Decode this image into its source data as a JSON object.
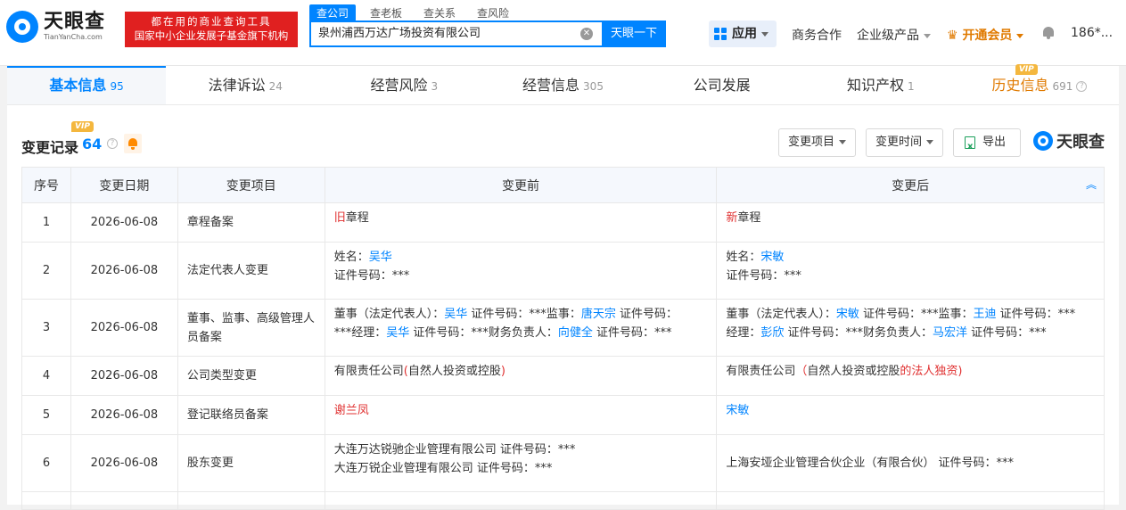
{
  "header": {
    "logo_cn": "天眼查",
    "logo_en": "TianYanCha.com",
    "slogan_line1": "都在用的商业查询工具",
    "slogan_line2": "国家中小企业发展子基金旗下机构",
    "search_tabs": [
      "查公司",
      "查老板",
      "查关系",
      "查风险"
    ],
    "search_value": "泉州浦西万达广场投资有限公司",
    "search_button": "天眼一下",
    "apps_label": "应用",
    "nav": {
      "business": "商务合作",
      "enterprise": "企业级产品",
      "vip": "开通会员",
      "user": "186*..."
    }
  },
  "tabs": [
    {
      "label": "基本信息",
      "count": "95"
    },
    {
      "label": "法律诉讼",
      "count": "24"
    },
    {
      "label": "经营风险",
      "count": "3"
    },
    {
      "label": "经营信息",
      "count": "305"
    },
    {
      "label": "公司发展",
      "count": ""
    },
    {
      "label": "知识产权",
      "count": "1"
    },
    {
      "label": "历史信息",
      "count": "691"
    }
  ],
  "vip_badge": "VIP",
  "section": {
    "title": "变更记录",
    "count": "64",
    "filter_item": "变更项目",
    "filter_time": "变更时间",
    "export": "导出",
    "brand": "天眼查"
  },
  "table": {
    "headers": [
      "序号",
      "变更日期",
      "变更项目",
      "变更前",
      "变更后"
    ],
    "rows": [
      {
        "no": "1",
        "date": "2026-06-08",
        "item": "章程备案"
      },
      {
        "no": "2",
        "date": "2026-06-08",
        "item": "法定代表人变更"
      },
      {
        "no": "3",
        "date": "2026-06-08",
        "item": "董事、监事、高级管理人员备案"
      },
      {
        "no": "4",
        "date": "2026-06-08",
        "item": "公司类型变更"
      },
      {
        "no": "5",
        "date": "2026-06-08",
        "item": "登记联络员备案"
      },
      {
        "no": "6",
        "date": "2026-06-08",
        "item": "股东变更"
      }
    ],
    "r1": {
      "before_mark": "旧",
      "before_text": "章程",
      "after_mark": "新",
      "after_text": "章程"
    },
    "r2": {
      "name_label": "姓名：",
      "id_line": "证件号码：***",
      "before_name": "吴华",
      "after_name": "宋敏"
    },
    "r3": {
      "b_p1": "董事（法定代表人）：",
      "b_n1": "吴华",
      "b_p2": " 证件号码：***监事：",
      "b_n2": "唐天宗",
      "b_p3": " 证件号码：",
      "b_p4": "***经理：",
      "b_n3": "吴华",
      "b_p5": " 证件号码：***财务负责人：",
      "b_n4": "向健全",
      "b_p6": " 证件号码：***",
      "a_p1": "董事（法定代表人）：",
      "a_n1": "宋敏",
      "a_p2": " 证件号码：***监事：",
      "a_n2": "王迪",
      "a_p3": " 证件号码：***",
      "a_p4": "经理：",
      "a_n3": "彭欣",
      "a_p5": " 证件号码：***财务负责人：",
      "a_n4": "马宏洋",
      "a_p6": " 证件号码：***"
    },
    "r4": {
      "before_plain": "有限责任公司",
      "before_red": "(",
      "before_plain2": "自然人投资或控股",
      "before_red2": ")",
      "after_plain": "有限责任公司",
      "after_red": "（",
      "after_plain2": "自然人投资或控股",
      "after_red2": "的法人独资)"
    },
    "r5": {
      "before": "谢兰凤",
      "after": "宋敏"
    },
    "r6": {
      "before_line1": "大连万达锐驰企业管理有限公司 证件号码：***",
      "before_line2": "大连万锐企业管理有限公司 证件号码：***",
      "after_line1": "上海安垭企业管理合伙企业（有限合伙） 证件号码：***"
    }
  },
  "colors": {
    "accent": "#0084ff",
    "vip": "#e07a00",
    "slogan_bg": "#e02020",
    "red": "#e03030"
  }
}
